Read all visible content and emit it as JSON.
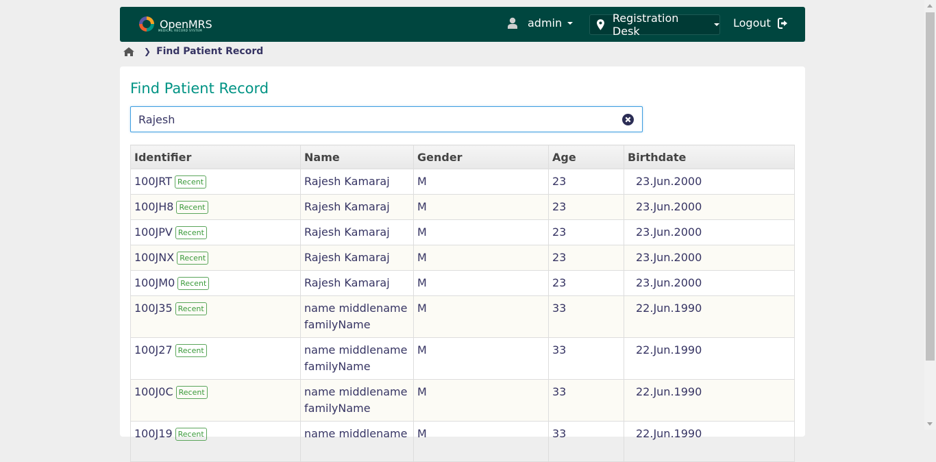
{
  "header": {
    "logo_text": "OpenMRS",
    "logo_sub": "MEDICAL RECORD SYSTEM",
    "user": "admin",
    "location": "Registration Desk",
    "logout": "Logout"
  },
  "breadcrumb": {
    "current": "Find Patient Record"
  },
  "page": {
    "title": "Find Patient Record",
    "search_value": "Rajesh"
  },
  "table": {
    "columns": [
      "Identifier",
      "Name",
      "Gender",
      "Age",
      "Birthdate"
    ],
    "badge": "Recent",
    "rows": [
      {
        "id": "100JRT",
        "name": "Rajesh Kamaraj",
        "gender": "M",
        "age": "23",
        "birthdate": "23.Jun.2000"
      },
      {
        "id": "100JH8",
        "name": "Rajesh Kamaraj",
        "gender": "M",
        "age": "23",
        "birthdate": "23.Jun.2000"
      },
      {
        "id": "100JPV",
        "name": "Rajesh Kamaraj",
        "gender": "M",
        "age": "23",
        "birthdate": "23.Jun.2000"
      },
      {
        "id": "100JNX",
        "name": "Rajesh Kamaraj",
        "gender": "M",
        "age": "23",
        "birthdate": "23.Jun.2000"
      },
      {
        "id": "100JM0",
        "name": "Rajesh Kamaraj",
        "gender": "M",
        "age": "23",
        "birthdate": "23.Jun.2000"
      },
      {
        "id": "100J35",
        "name": "name middlename familyName",
        "gender": "M",
        "age": "33",
        "birthdate": "22.Jun.1990"
      },
      {
        "id": "100J27",
        "name": "name middlename familyName",
        "gender": "M",
        "age": "33",
        "birthdate": "22.Jun.1990"
      },
      {
        "id": "100J0C",
        "name": "name middlename familyName",
        "gender": "M",
        "age": "33",
        "birthdate": "22.Jun.1990"
      },
      {
        "id": "100J19",
        "name": "name middlename",
        "gender": "M",
        "age": "33",
        "birthdate": "22.Jun.1990"
      }
    ]
  },
  "colors": {
    "header_bg": "#00463f",
    "title": "#009384",
    "badge": "#3a9a3a",
    "row_alt": "#fcfbf5"
  }
}
